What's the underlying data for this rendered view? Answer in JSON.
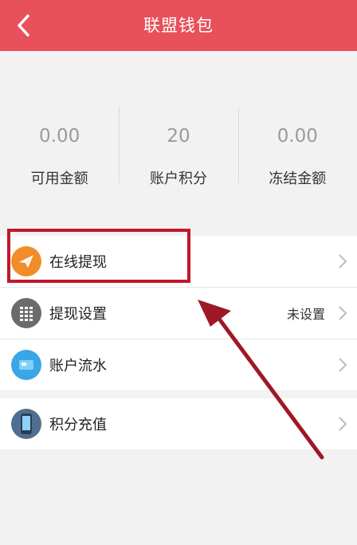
{
  "header": {
    "title": "联盟钱包",
    "back_icon": "chevron-left-icon"
  },
  "stats": [
    {
      "value": "0.00",
      "label": "可用金额"
    },
    {
      "value": "20",
      "label": "账户积分"
    },
    {
      "value": "0.00",
      "label": "冻结金额"
    }
  ],
  "menu": {
    "items": [
      {
        "label": "在线提现",
        "icon": "paper-plane-icon",
        "value": ""
      },
      {
        "label": "提现设置",
        "icon": "keypad-icon",
        "value": "未设置"
      },
      {
        "label": "账户流水",
        "icon": "card-icon",
        "value": ""
      }
    ],
    "items2": [
      {
        "label": "积分充值",
        "icon": "phone-icon",
        "value": ""
      }
    ]
  },
  "colors": {
    "header": "#e8505b",
    "highlight": "#c0172b",
    "arrow": "#9e1826"
  }
}
